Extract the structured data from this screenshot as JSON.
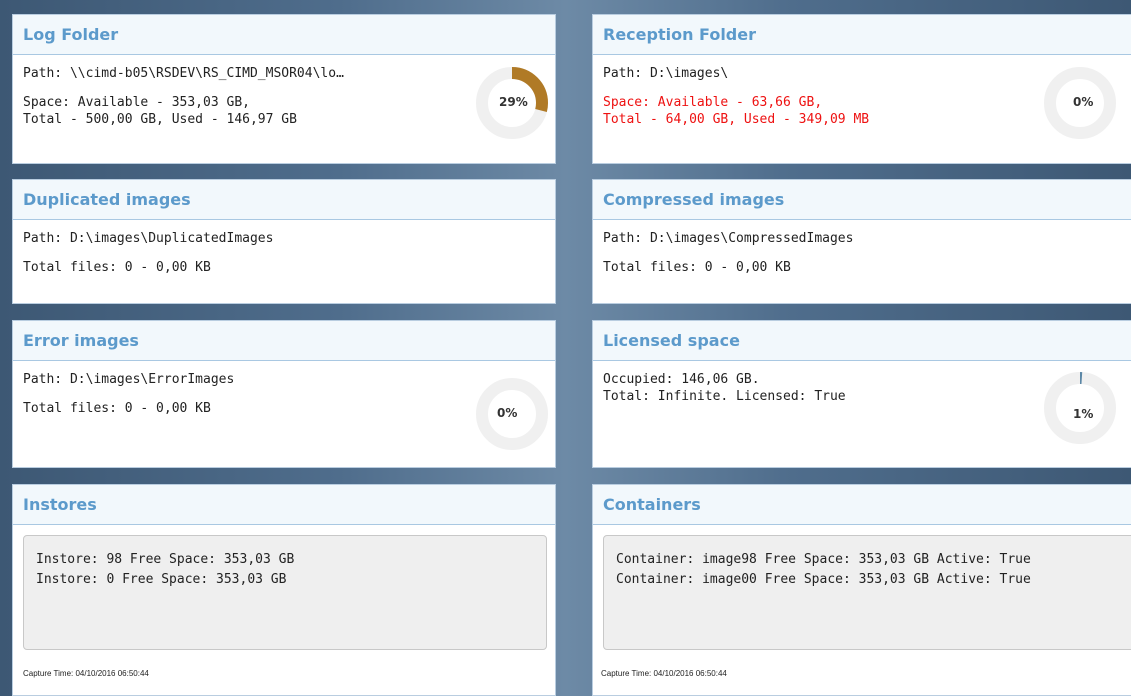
{
  "log_folder": {
    "title": "Log Folder",
    "path": "Path: \\\\cimd-b05\\RSDEV\\RS_CIMD_MSOR04\\lo…",
    "space_line1": "Space: Available - 353,03 GB,",
    "space_line2": "Total - 500,00 GB, Used - 146,97 GB",
    "percent_label": "29%",
    "percent": 29,
    "color": "#b07a26"
  },
  "reception_folder": {
    "title": "Reception Folder",
    "path": "Path: D:\\images\\",
    "space_line1": "Space: Available - 63,66 GB,",
    "space_line2": "Total - 64,00 GB, Used - 349,09 MB",
    "percent_label": "0%",
    "percent": 0,
    "alert_color": "#ee1111"
  },
  "duplicated_images": {
    "title": "Duplicated images",
    "path": "Path: D:\\images\\DuplicatedImages",
    "total": "Total files: 0 - 0,00 KB"
  },
  "compressed_images": {
    "title": "Compressed images",
    "path": "Path: D:\\images\\CompressedImages",
    "total": "Total files: 0 - 0,00 KB"
  },
  "error_images": {
    "title": "Error images",
    "path": "Path: D:\\images\\ErrorImages",
    "total": "Total files: 0 - 0,00 KB",
    "percent_label": "0%",
    "percent": 0
  },
  "licensed_space": {
    "title": "Licensed space",
    "occupied": "Occupied: 146,06 GB.",
    "total": "Total: Infinite. Licensed: True",
    "percent_label": "1%",
    "percent": 1,
    "color": "#5b87a6"
  },
  "instores": {
    "title": "Instores",
    "items": [
      "Instore: 98 Free Space: 353,03 GB",
      "Instore: 0 Free Space: 353,03 GB"
    ],
    "capture_time": "Capture Time: 04/10/2016 06:50:44"
  },
  "containers": {
    "title": "Containers",
    "items": [
      "Container: image98 Free Space: 353,03 GB Active: True",
      "Container: image00 Free Space: 353,03 GB Active: True"
    ],
    "capture_time": "Capture Time: 04/10/2016 06:50:44"
  }
}
